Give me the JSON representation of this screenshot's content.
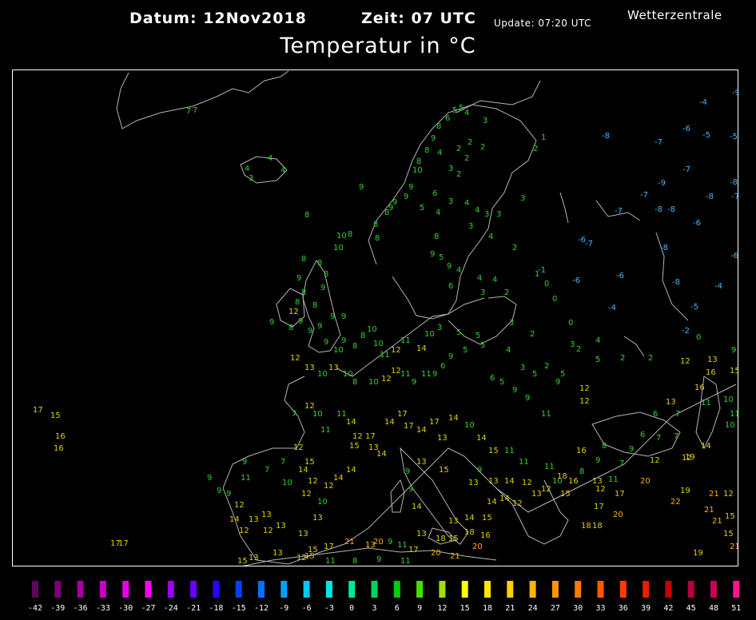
{
  "header": {
    "datum": "Datum: 12Nov2018",
    "zeit": "Zeit: 07 UTC",
    "update": "Update: 07:20 UTC",
    "brand": "Wetterzentrale",
    "title": "Temperatur in °C"
  },
  "colors": {
    "coast": "#b4b4b4",
    "green": "#2fd22f",
    "yellow": "#e0d000",
    "blue": "#43b6ff",
    "orange": "#ffb000"
  },
  "stations": [
    [
      232,
      141,
      7
    ],
    [
      240,
      140,
      7
    ],
    [
      334,
      200,
      4
    ],
    [
      350,
      215,
      4
    ],
    [
      305,
      213,
      4
    ],
    [
      310,
      225,
      3
    ],
    [
      448,
      236,
      9
    ],
    [
      380,
      271,
      8
    ],
    [
      420,
      297,
      10
    ],
    [
      416,
      312,
      10
    ],
    [
      434,
      295,
      8
    ],
    [
      466,
      283,
      8
    ],
    [
      468,
      300,
      8
    ],
    [
      480,
      268,
      8
    ],
    [
      485,
      262,
      9
    ],
    [
      490,
      255,
      9
    ],
    [
      504,
      248,
      9
    ],
    [
      510,
      236,
      9
    ],
    [
      515,
      215,
      10
    ],
    [
      520,
      204,
      8
    ],
    [
      530,
      190,
      8
    ],
    [
      538,
      175,
      9
    ],
    [
      545,
      160,
      8
    ],
    [
      556,
      150,
      6
    ],
    [
      565,
      140,
      5
    ],
    [
      573,
      137,
      5
    ],
    [
      580,
      143,
      4
    ],
    [
      603,
      153,
      3
    ],
    [
      546,
      193,
      4
    ],
    [
      570,
      188,
      2
    ],
    [
      584,
      180,
      2
    ],
    [
      600,
      186,
      2
    ],
    [
      580,
      200,
      2
    ],
    [
      560,
      213,
      3
    ],
    [
      570,
      220,
      2
    ],
    [
      540,
      244,
      6
    ],
    [
      524,
      262,
      5
    ],
    [
      544,
      268,
      4
    ],
    [
      560,
      254,
      3
    ],
    [
      580,
      256,
      4
    ],
    [
      593,
      265,
      4
    ],
    [
      605,
      270,
      3
    ],
    [
      620,
      270,
      3
    ],
    [
      585,
      285,
      3
    ],
    [
      610,
      298,
      4
    ],
    [
      542,
      298,
      8
    ],
    [
      537,
      320,
      9
    ],
    [
      548,
      324,
      5
    ],
    [
      558,
      335,
      9
    ],
    [
      570,
      340,
      4
    ],
    [
      560,
      360,
      6
    ],
    [
      596,
      350,
      4
    ],
    [
      615,
      352,
      4
    ],
    [
      600,
      368,
      3
    ],
    [
      630,
      368,
      2
    ],
    [
      640,
      312,
      2
    ],
    [
      676,
      174,
      1
    ],
    [
      666,
      188,
      2
    ],
    [
      650,
      250,
      3
    ],
    [
      668,
      345,
      1
    ],
    [
      680,
      357,
      0
    ],
    [
      690,
      376,
      0
    ],
    [
      710,
      406,
      0
    ],
    [
      672,
      340,
      -1
    ],
    [
      715,
      353,
      -6
    ],
    [
      770,
      347,
      -6
    ],
    [
      760,
      387,
      -4
    ],
    [
      722,
      302,
      -6
    ],
    [
      731,
      307,
      -7
    ],
    [
      752,
      172,
      -8
    ],
    [
      818,
      180,
      -7
    ],
    [
      853,
      163,
      -6
    ],
    [
      878,
      171,
      -5
    ],
    [
      912,
      173,
      -5
    ],
    [
      874,
      130,
      -4
    ],
    [
      915,
      118,
      -9
    ],
    [
      853,
      214,
      -7
    ],
    [
      822,
      231,
      -9
    ],
    [
      800,
      246,
      -7
    ],
    [
      768,
      266,
      -7
    ],
    [
      818,
      264,
      -8
    ],
    [
      834,
      264,
      -8
    ],
    [
      866,
      281,
      -6
    ],
    [
      882,
      248,
      -8
    ],
    [
      914,
      248,
      -7
    ],
    [
      912,
      230,
      -8
    ],
    [
      825,
      312,
      -8
    ],
    [
      913,
      322,
      -6
    ],
    [
      840,
      355,
      -8
    ],
    [
      893,
      360,
      -4
    ],
    [
      863,
      386,
      -5
    ],
    [
      852,
      416,
      -2
    ],
    [
      870,
      424,
      0
    ],
    [
      720,
      439,
      2
    ],
    [
      712,
      433,
      3
    ],
    [
      744,
      428,
      4
    ],
    [
      662,
      420,
      2
    ],
    [
      636,
      406,
      3
    ],
    [
      594,
      422,
      5
    ],
    [
      570,
      418,
      5
    ],
    [
      546,
      412,
      3
    ],
    [
      530,
      420,
      10
    ],
    [
      520,
      438,
      14
    ],
    [
      500,
      428,
      11
    ],
    [
      488,
      440,
      12
    ],
    [
      474,
      446,
      11
    ],
    [
      466,
      432,
      10
    ],
    [
      458,
      414,
      10
    ],
    [
      450,
      422,
      8
    ],
    [
      440,
      435,
      8
    ],
    [
      426,
      428,
      9
    ],
    [
      416,
      440,
      10
    ],
    [
      404,
      430,
      9
    ],
    [
      396,
      410,
      9
    ],
    [
      384,
      416,
      9
    ],
    [
      372,
      404,
      9
    ],
    [
      360,
      392,
      12
    ],
    [
      368,
      380,
      8
    ],
    [
      376,
      368,
      8
    ],
    [
      370,
      350,
      9
    ],
    [
      376,
      326,
      8
    ],
    [
      396,
      331,
      8
    ],
    [
      404,
      345,
      8
    ],
    [
      400,
      362,
      9
    ],
    [
      390,
      384,
      8
    ],
    [
      412,
      398,
      9
    ],
    [
      426,
      398,
      9
    ],
    [
      360,
      412,
      8
    ],
    [
      336,
      405,
      9
    ],
    [
      362,
      450,
      12
    ],
    [
      380,
      462,
      13
    ],
    [
      396,
      470,
      10
    ],
    [
      410,
      462,
      13
    ],
    [
      428,
      470,
      10
    ],
    [
      440,
      480,
      8
    ],
    [
      460,
      480,
      10
    ],
    [
      476,
      476,
      12
    ],
    [
      488,
      466,
      12
    ],
    [
      500,
      470,
      11
    ],
    [
      514,
      480,
      9
    ],
    [
      526,
      470,
      11
    ],
    [
      540,
      470,
      9
    ],
    [
      550,
      460,
      6
    ],
    [
      560,
      448,
      9
    ],
    [
      578,
      440,
      5
    ],
    [
      600,
      434,
      5
    ],
    [
      632,
      440,
      4
    ],
    [
      650,
      462,
      3
    ],
    [
      665,
      470,
      5
    ],
    [
      680,
      460,
      2
    ],
    [
      700,
      470,
      5
    ],
    [
      612,
      475,
      6
    ],
    [
      624,
      480,
      5
    ],
    [
      640,
      490,
      9
    ],
    [
      656,
      500,
      9
    ],
    [
      676,
      520,
      11
    ],
    [
      694,
      480,
      9
    ],
    [
      724,
      488,
      12
    ],
    [
      724,
      504,
      12
    ],
    [
      744,
      452,
      5
    ],
    [
      775,
      450,
      2
    ],
    [
      810,
      450,
      2
    ],
    [
      850,
      454,
      12
    ],
    [
      884,
      452,
      13
    ],
    [
      882,
      468,
      16
    ],
    [
      912,
      466,
      15
    ],
    [
      914,
      440,
      9
    ],
    [
      868,
      487,
      16
    ],
    [
      904,
      502,
      10
    ],
    [
      876,
      506,
      11
    ],
    [
      912,
      520,
      11
    ],
    [
      906,
      534,
      10
    ],
    [
      832,
      505,
      13
    ],
    [
      844,
      520,
      7
    ],
    [
      816,
      520,
      6
    ],
    [
      800,
      546,
      6
    ],
    [
      820,
      550,
      7
    ],
    [
      842,
      548,
      7
    ],
    [
      876,
      560,
      14
    ],
    [
      852,
      575,
      12
    ],
    [
      812,
      578,
      12
    ],
    [
      786,
      564,
      9
    ],
    [
      774,
      582,
      7
    ],
    [
      752,
      560,
      8
    ],
    [
      744,
      578,
      9
    ],
    [
      720,
      566,
      16
    ],
    [
      724,
      592,
      8
    ],
    [
      740,
      604,
      13
    ],
    [
      710,
      604,
      16
    ],
    [
      700,
      620,
      15
    ],
    [
      690,
      604,
      10
    ],
    [
      676,
      614,
      12
    ],
    [
      664,
      620,
      13
    ],
    [
      652,
      606,
      12
    ],
    [
      630,
      604,
      14
    ],
    [
      610,
      604,
      13
    ],
    [
      596,
      590,
      9
    ],
    [
      585,
      606,
      13
    ],
    [
      548,
      590,
      15
    ],
    [
      520,
      580,
      13
    ],
    [
      506,
      592,
      9
    ],
    [
      510,
      614,
      9
    ],
    [
      514,
      636,
      14
    ],
    [
      470,
      570,
      14
    ],
    [
      460,
      562,
      13
    ],
    [
      440,
      548,
      12
    ],
    [
      432,
      530,
      14
    ],
    [
      420,
      520,
      11
    ],
    [
      400,
      540,
      11
    ],
    [
      390,
      520,
      10
    ],
    [
      380,
      510,
      12
    ],
    [
      364,
      520,
      7
    ],
    [
      366,
      562,
      12
    ],
    [
      380,
      580,
      15
    ],
    [
      384,
      604,
      12
    ],
    [
      404,
      610,
      12
    ],
    [
      416,
      600,
      14
    ],
    [
      432,
      590,
      14
    ],
    [
      436,
      560,
      15
    ],
    [
      456,
      548,
      17
    ],
    [
      480,
      530,
      14
    ],
    [
      496,
      520,
      17
    ],
    [
      504,
      535,
      17
    ],
    [
      520,
      540,
      14
    ],
    [
      536,
      530,
      17
    ],
    [
      546,
      550,
      13
    ],
    [
      560,
      525,
      14
    ],
    [
      580,
      534,
      10
    ],
    [
      595,
      550,
      14
    ],
    [
      610,
      566,
      15
    ],
    [
      630,
      566,
      11
    ],
    [
      648,
      580,
      11
    ],
    [
      680,
      586,
      11
    ],
    [
      696,
      598,
      18
    ],
    [
      744,
      614,
      12
    ],
    [
      760,
      602,
      11
    ],
    [
      768,
      620,
      17
    ],
    [
      742,
      636,
      17
    ],
    [
      726,
      660,
      18
    ],
    [
      766,
      646,
      20
    ],
    [
      740,
      660,
      18
    ],
    [
      800,
      604,
      20
    ],
    [
      838,
      630,
      22
    ],
    [
      850,
      616,
      19
    ],
    [
      856,
      574,
      19
    ],
    [
      886,
      620,
      21
    ],
    [
      904,
      620,
      12
    ],
    [
      880,
      640,
      21
    ],
    [
      890,
      654,
      21
    ],
    [
      906,
      648,
      15
    ],
    [
      904,
      670,
      15
    ],
    [
      912,
      686,
      21
    ],
    [
      866,
      694,
      19
    ],
    [
      302,
      580,
      9
    ],
    [
      300,
      600,
      11
    ],
    [
      282,
      620,
      9
    ],
    [
      292,
      634,
      12
    ],
    [
      286,
      652,
      14
    ],
    [
      298,
      666,
      12
    ],
    [
      310,
      652,
      13
    ],
    [
      326,
      646,
      13
    ],
    [
      328,
      666,
      12
    ],
    [
      344,
      660,
      13
    ],
    [
      330,
      590,
      7
    ],
    [
      350,
      580,
      7
    ],
    [
      352,
      606,
      10
    ],
    [
      372,
      590,
      14
    ],
    [
      376,
      620,
      12
    ],
    [
      396,
      630,
      10
    ],
    [
      390,
      650,
      13
    ],
    [
      372,
      670,
      13
    ],
    [
      384,
      690,
      15
    ],
    [
      404,
      686,
      17
    ],
    [
      430,
      680,
      21
    ],
    [
      456,
      684,
      13
    ],
    [
      466,
      680,
      20
    ],
    [
      484,
      680,
      9
    ],
    [
      496,
      684,
      11
    ],
    [
      520,
      670,
      13
    ],
    [
      544,
      676,
      18
    ],
    [
      560,
      676,
      15
    ],
    [
      580,
      668,
      18
    ],
    [
      590,
      686,
      20
    ],
    [
      600,
      672,
      16
    ],
    [
      602,
      650,
      15
    ],
    [
      608,
      630,
      14
    ],
    [
      624,
      626,
      14
    ],
    [
      640,
      632,
      12
    ],
    [
      560,
      654,
      13
    ],
    [
      580,
      650,
      14
    ],
    [
      510,
      690,
      17
    ],
    [
      538,
      694,
      20
    ],
    [
      562,
      698,
      21
    ],
    [
      296,
      704,
      15
    ],
    [
      310,
      700,
      13
    ],
    [
      340,
      694,
      13
    ],
    [
      370,
      700,
      12
    ],
    [
      380,
      698,
      15
    ],
    [
      406,
      704,
      11
    ],
    [
      440,
      704,
      8
    ],
    [
      470,
      702,
      9
    ],
    [
      500,
      704,
      11
    ],
    [
      40,
      515,
      17
    ],
    [
      62,
      522,
      15
    ],
    [
      68,
      548,
      16
    ],
    [
      66,
      563,
      16
    ],
    [
      137,
      682,
      17
    ],
    [
      147,
      682,
      17
    ],
    [
      258,
      600,
      9
    ],
    [
      270,
      616,
      9
    ]
  ],
  "legend": {
    "values": [
      "-42",
      "-39",
      "-36",
      "-33",
      "-30",
      "-27",
      "-24",
      "-21",
      "-18",
      "-15",
      "-12",
      "-9",
      "-6",
      "-3",
      "0",
      "3",
      "6",
      "9",
      "12",
      "15",
      "18",
      "21",
      "24",
      "27",
      "30",
      "33",
      "36",
      "39",
      "42",
      "45",
      "48",
      "51"
    ],
    "colors": [
      "#5a0a5a",
      "#7a007a",
      "#a000a0",
      "#c800c8",
      "#e600e6",
      "#ff00ff",
      "#9a00ff",
      "#6a00ff",
      "#3000ff",
      "#0040ff",
      "#0070ff",
      "#00a0ff",
      "#00c8ff",
      "#00e6e6",
      "#00e6a0",
      "#00d060",
      "#00d000",
      "#40e000",
      "#a0e000",
      "#ffff00",
      "#ffe600",
      "#ffd000",
      "#ffb400",
      "#ff9600",
      "#ff7800",
      "#ff5a00",
      "#ff3c00",
      "#e61e00",
      "#c80000",
      "#b4003c",
      "#c8005a",
      "#ff1493"
    ]
  }
}
